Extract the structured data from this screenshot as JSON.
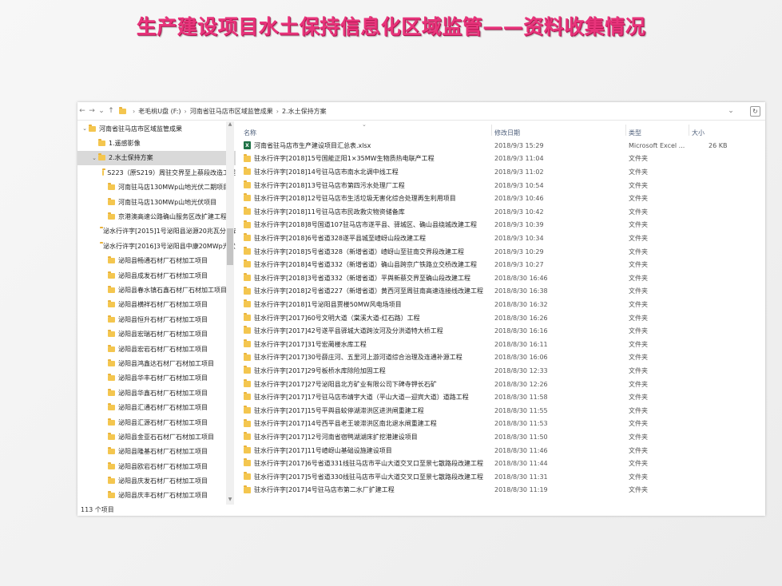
{
  "slide_title": "生产建设项目水土保持信息化区域监管——资料收集情况",
  "address": {
    "crumbs": [
      "老毛桃U盘 (F:)",
      "河南省驻马店市区域监管成果",
      "2.水土保持方案"
    ]
  },
  "nav": {
    "items": [
      {
        "label": "河南省驻马店市区域监管成果",
        "indent": 0,
        "arrow": "v",
        "selected": false
      },
      {
        "label": "1.遥感影像",
        "indent": 1,
        "arrow": "",
        "selected": false
      },
      {
        "label": "2.水土保持方案",
        "indent": 1,
        "arrow": "v",
        "selected": true
      },
      {
        "label": "S223（原S219）周驻交界至上蔡段改造工程",
        "indent": 2,
        "arrow": "",
        "selected": false
      },
      {
        "label": "河南驻马店130MWp山地光伏二期项目",
        "indent": 2,
        "arrow": "",
        "selected": false
      },
      {
        "label": "河南驻马店130MWp山地光伏项目",
        "indent": 2,
        "arrow": "",
        "selected": false
      },
      {
        "label": "京港澳高速公路确山服务区改扩建工程",
        "indent": 2,
        "arrow": "",
        "selected": false
      },
      {
        "label": "泌水行许字[2015]1号泌阳县泌源20兆瓦分布式光伏",
        "indent": 2,
        "arrow": "",
        "selected": false
      },
      {
        "label": "泌水行许字[2016]3号泌阳县中康20MWp光伏电站",
        "indent": 2,
        "arrow": "",
        "selected": false
      },
      {
        "label": "泌阳县畅通石材厂石材加工项目",
        "indent": 2,
        "arrow": "",
        "selected": false
      },
      {
        "label": "泌阳县成发石材厂石材加工项目",
        "indent": 2,
        "arrow": "",
        "selected": false
      },
      {
        "label": "泌阳县春水镇石鑫石材厂石材加工项目",
        "indent": 2,
        "arrow": "",
        "selected": false
      },
      {
        "label": "泌阳县横祥石材厂石材加工项目",
        "indent": 2,
        "arrow": "",
        "selected": false
      },
      {
        "label": "泌阳县恒升石材厂石材加工项目",
        "indent": 2,
        "arrow": "",
        "selected": false
      },
      {
        "label": "泌阳县宏瑞石材厂石材加工项目",
        "indent": 2,
        "arrow": "",
        "selected": false
      },
      {
        "label": "泌阳县宏岩石材厂石材加工项目",
        "indent": 2,
        "arrow": "",
        "selected": false
      },
      {
        "label": "泌阳县鸿鑫达石材厂石材加工项目",
        "indent": 2,
        "arrow": "",
        "selected": false
      },
      {
        "label": "泌阳县华丰石材厂石材加工项目",
        "indent": 2,
        "arrow": "",
        "selected": false
      },
      {
        "label": "泌阳县华鑫石材厂石材加工项目",
        "indent": 2,
        "arrow": "",
        "selected": false
      },
      {
        "label": "泌阳县汇通石材厂石材加工项目",
        "indent": 2,
        "arrow": "",
        "selected": false
      },
      {
        "label": "泌阳县汇源石材厂石材加工项目",
        "indent": 2,
        "arrow": "",
        "selected": false
      },
      {
        "label": "泌阳县金亚石石材厂石材加工项目",
        "indent": 2,
        "arrow": "",
        "selected": false
      },
      {
        "label": "泌阳县隆基石材厂石材加工项目",
        "indent": 2,
        "arrow": "",
        "selected": false
      },
      {
        "label": "泌阳县欧岩石材厂石材加工项目",
        "indent": 2,
        "arrow": "",
        "selected": false
      },
      {
        "label": "泌阳县庆发石材厂石材加工项目",
        "indent": 2,
        "arrow": "",
        "selected": false
      },
      {
        "label": "泌阳县庆丰石材厂石材加工项目",
        "indent": 2,
        "arrow": "",
        "selected": false
      }
    ]
  },
  "status": {
    "count": "113 个项目"
  },
  "columns": {
    "name": "名称",
    "date": "修改日期",
    "type": "类型",
    "size": "大小"
  },
  "files": [
    {
      "name": "河南省驻马店市生产建设项目汇总表.xlsx",
      "date": "2018/9/3 15:29",
      "type": "Microsoft Excel ...",
      "size": "26 KB",
      "icon": "excel"
    },
    {
      "name": "驻水行许字[2018]15号国能正阳1×35MW生物质热电联产工程",
      "date": "2018/9/3 11:04",
      "type": "文件夹",
      "size": "",
      "icon": "folder"
    },
    {
      "name": "驻水行许字[2018]14号驻马店市南水北调中线工程",
      "date": "2018/9/3 11:02",
      "type": "文件夹",
      "size": "",
      "icon": "folder"
    },
    {
      "name": "驻水行许字[2018]13号驻马店市第四污水处理厂工程",
      "date": "2018/9/3 10:54",
      "type": "文件夹",
      "size": "",
      "icon": "folder"
    },
    {
      "name": "驻水行许字[2018]12号驻马店市生活垃圾无害化综合处理再生利用项目",
      "date": "2018/9/3 10:46",
      "type": "文件夹",
      "size": "",
      "icon": "folder"
    },
    {
      "name": "驻水行许字[2018]11号驻马店市民政救灾物资储备库",
      "date": "2018/9/3 10:42",
      "type": "文件夹",
      "size": "",
      "icon": "folder"
    },
    {
      "name": "驻水行许字[2018]8号国道107驻马店市遂平县、驿城区、确山县绕城改建工程",
      "date": "2018/9/3 10:39",
      "type": "文件夹",
      "size": "",
      "icon": "folder"
    },
    {
      "name": "驻水行许字[2018]6号省道328遂平县城至嵖岈山段改建工程",
      "date": "2018/9/3 10:34",
      "type": "文件夹",
      "size": "",
      "icon": "folder"
    },
    {
      "name": "驻水行许字[2018]5号省道328（新增省道）嵖岈山至驻南交界段改建工程",
      "date": "2018/9/3 10:29",
      "type": "文件夹",
      "size": "",
      "icon": "folder"
    },
    {
      "name": "驻水行许字[2018]4号省道332（新增省道）确山县跨京广铁路立交桥改建工程",
      "date": "2018/9/3 10:27",
      "type": "文件夹",
      "size": "",
      "icon": "folder"
    },
    {
      "name": "驻水行许字[2018]3号省道332（新增省道）平舆新蔡交界至确山段改建工程",
      "date": "2018/8/30 16:46",
      "type": "文件夹",
      "size": "",
      "icon": "folder"
    },
    {
      "name": "驻水行许字[2018]2号省道227（新增省道）黄西河至周驻南高速连接线改建工程",
      "date": "2018/8/30 16:38",
      "type": "文件夹",
      "size": "",
      "icon": "folder"
    },
    {
      "name": "驻水行许字[2018]1号泌阳县贾楼50MW风电场项目",
      "date": "2018/8/30 16:32",
      "type": "文件夹",
      "size": "",
      "icon": "folder"
    },
    {
      "name": "驻水行许字[2017]60号文明大道（棠溪大道-红石路）工程",
      "date": "2018/8/30 16:26",
      "type": "文件夹",
      "size": "",
      "icon": "folder"
    },
    {
      "name": "驻水行许字[2017]42号遂平县驿城大道跨汝河及分洪道特大桥工程",
      "date": "2018/8/30 16:16",
      "type": "文件夹",
      "size": "",
      "icon": "folder"
    },
    {
      "name": "驻水行许字[2017]31号宏蔺楼水库工程",
      "date": "2018/8/30 16:11",
      "type": "文件夹",
      "size": "",
      "icon": "folder"
    },
    {
      "name": "驻水行许字[2017]30号薛庄河、五里河上游河道综合治理及连通补源工程",
      "date": "2018/8/30 16:06",
      "type": "文件夹",
      "size": "",
      "icon": "folder"
    },
    {
      "name": "驻水行许字[2017]29号板桥水库除险加固工程",
      "date": "2018/8/30 12:33",
      "type": "文件夹",
      "size": "",
      "icon": "folder"
    },
    {
      "name": "驻水行许字[2017]27号泌阳县北方矿业有限公司下碑寺钾长石矿",
      "date": "2018/8/30 12:26",
      "type": "文件夹",
      "size": "",
      "icon": "folder"
    },
    {
      "name": "驻水行许字[2017]17号驻马店市靖宇大道（平山大道—迎宾大道）道路工程",
      "date": "2018/8/30 11:58",
      "type": "文件夹",
      "size": "",
      "icon": "folder"
    },
    {
      "name": "驻水行许字[2017]15号平舆县蛟停湖滞洪区进洪闸重建工程",
      "date": "2018/8/30 11:55",
      "type": "文件夹",
      "size": "",
      "icon": "folder"
    },
    {
      "name": "驻水行许字[2017]14号西平县老王坡滞洪区南北退水闸重建工程",
      "date": "2018/8/30 11:53",
      "type": "文件夹",
      "size": "",
      "icon": "folder"
    },
    {
      "name": "驻水行许字[2017]12号河南省宿鸭湖湖床扩挖港建设项目",
      "date": "2018/8/30 11:50",
      "type": "文件夹",
      "size": "",
      "icon": "folder"
    },
    {
      "name": "驻水行许字[2017]11号嵖岈山基础设施建设项目",
      "date": "2018/8/30 11:46",
      "type": "文件夹",
      "size": "",
      "icon": "folder"
    },
    {
      "name": "驻水行许字[2017]6号省道331线驻马店市平山大道交叉口至景七散路段改建工程",
      "date": "2018/8/30 11:44",
      "type": "文件夹",
      "size": "",
      "icon": "folder"
    },
    {
      "name": "驻水行许字[2017]5号省道330线驻马店市平山大道交叉口至景七散路段改建工程",
      "date": "2018/8/30 11:31",
      "type": "文件夹",
      "size": "",
      "icon": "folder"
    },
    {
      "name": "驻水行许字[2017]4号驻马店市第二水厂扩建工程",
      "date": "2018/8/30 11:19",
      "type": "文件夹",
      "size": "",
      "icon": "folder"
    }
  ]
}
